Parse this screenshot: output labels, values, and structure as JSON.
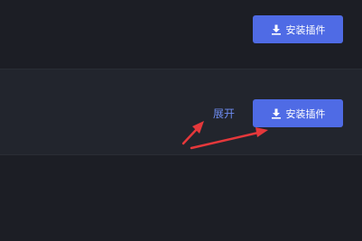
{
  "plugins": [
    {
      "install_label": "安装插件"
    },
    {
      "install_label": "安装插件",
      "expand_label": "展开"
    }
  ],
  "icons": {
    "install": "download-icon"
  },
  "colors": {
    "button_bg": "#4f6be5",
    "link": "#6d8cf0",
    "annotation_arrow": "#e5383b",
    "background": "#1c1e25",
    "row_highlight": "#22252d"
  }
}
